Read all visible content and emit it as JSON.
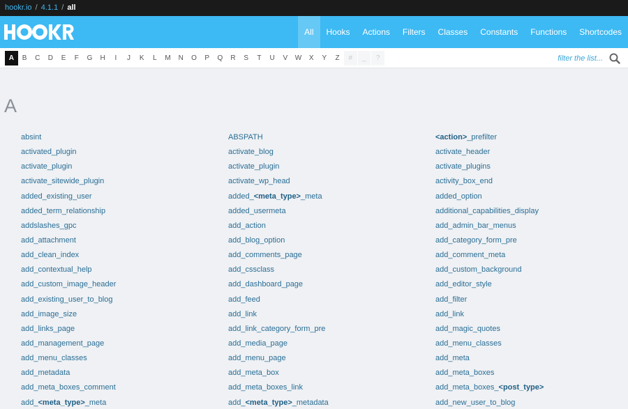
{
  "breadcrumb": {
    "site": "hookr.io",
    "version": "4.1.1",
    "current": "all",
    "separator": "/"
  },
  "logo": {
    "text": "HOOKR"
  },
  "nav": {
    "tabs": [
      {
        "label": "All",
        "active": true
      },
      {
        "label": "Hooks"
      },
      {
        "label": "Actions"
      },
      {
        "label": "Filters"
      },
      {
        "label": "Classes"
      },
      {
        "label": "Constants"
      },
      {
        "label": "Functions"
      },
      {
        "label": "Shortcodes"
      }
    ]
  },
  "letters": {
    "items": [
      "A",
      "B",
      "C",
      "D",
      "E",
      "F",
      "G",
      "H",
      "I",
      "J",
      "K",
      "L",
      "M",
      "N",
      "O",
      "P",
      "Q",
      "R",
      "S",
      "T",
      "U",
      "V",
      "W",
      "X",
      "Y",
      "Z",
      "#",
      "_",
      "?"
    ],
    "active": "A",
    "disabled": [
      "#",
      "_",
      "?"
    ]
  },
  "filter": {
    "placeholder": "filter the list...",
    "icon": "search-icon"
  },
  "section": {
    "heading": "A"
  },
  "columns": [
    [
      {
        "text": "absint"
      },
      {
        "text": "activated_plugin"
      },
      {
        "text": "activate_plugin"
      },
      {
        "text": "activate_sitewide_plugin"
      },
      {
        "text": "added_existing_user"
      },
      {
        "text": "added_term_relationship"
      },
      {
        "text": "addslashes_gpc"
      },
      {
        "text": "add_attachment"
      },
      {
        "text": "add_clean_index"
      },
      {
        "text": "add_contextual_help"
      },
      {
        "text": "add_custom_image_header"
      },
      {
        "text": "add_existing_user_to_blog"
      },
      {
        "text": "add_image_size"
      },
      {
        "text": "add_links_page"
      },
      {
        "text": "add_management_page"
      },
      {
        "text": "add_menu_classes"
      },
      {
        "text": "add_metadata"
      },
      {
        "text": "add_meta_boxes_comment"
      },
      {
        "pre": "add_",
        "bold": "<meta_type>",
        "post": "_meta"
      }
    ],
    [
      {
        "text": "ABSPATH"
      },
      {
        "text": "activate_blog"
      },
      {
        "text": "activate_plugin"
      },
      {
        "text": "activate_wp_head"
      },
      {
        "pre": "added_",
        "bold": "<meta_type>",
        "post": "_meta"
      },
      {
        "text": "added_usermeta"
      },
      {
        "text": "add_action"
      },
      {
        "text": "add_blog_option"
      },
      {
        "text": "add_comments_page"
      },
      {
        "text": "add_cssclass"
      },
      {
        "text": "add_dashboard_page"
      },
      {
        "text": "add_feed"
      },
      {
        "text": "add_link"
      },
      {
        "text": "add_link_category_form_pre"
      },
      {
        "text": "add_media_page"
      },
      {
        "text": "add_menu_page"
      },
      {
        "text": "add_meta_box"
      },
      {
        "text": "add_meta_boxes_link"
      },
      {
        "pre": "add_",
        "bold": "<meta_type>",
        "post": "_metadata"
      }
    ],
    [
      {
        "pre": "",
        "bold": "<action>",
        "post": "_prefilter"
      },
      {
        "text": "activate_header"
      },
      {
        "text": "activate_plugins"
      },
      {
        "text": "activity_box_end"
      },
      {
        "text": "added_option"
      },
      {
        "text": "additional_capabilities_display"
      },
      {
        "text": "add_admin_bar_menus"
      },
      {
        "text": "add_category_form_pre"
      },
      {
        "text": "add_comment_meta"
      },
      {
        "text": "add_custom_background"
      },
      {
        "text": "add_editor_style"
      },
      {
        "text": "add_filter"
      },
      {
        "text": "add_link"
      },
      {
        "text": "add_magic_quotes"
      },
      {
        "text": "add_menu_classes"
      },
      {
        "text": "add_meta"
      },
      {
        "text": "add_meta_boxes"
      },
      {
        "pre": "add_meta_boxes_",
        "bold": "<post_type>",
        "post": ""
      },
      {
        "text": "add_new_user_to_blog"
      }
    ]
  ]
}
